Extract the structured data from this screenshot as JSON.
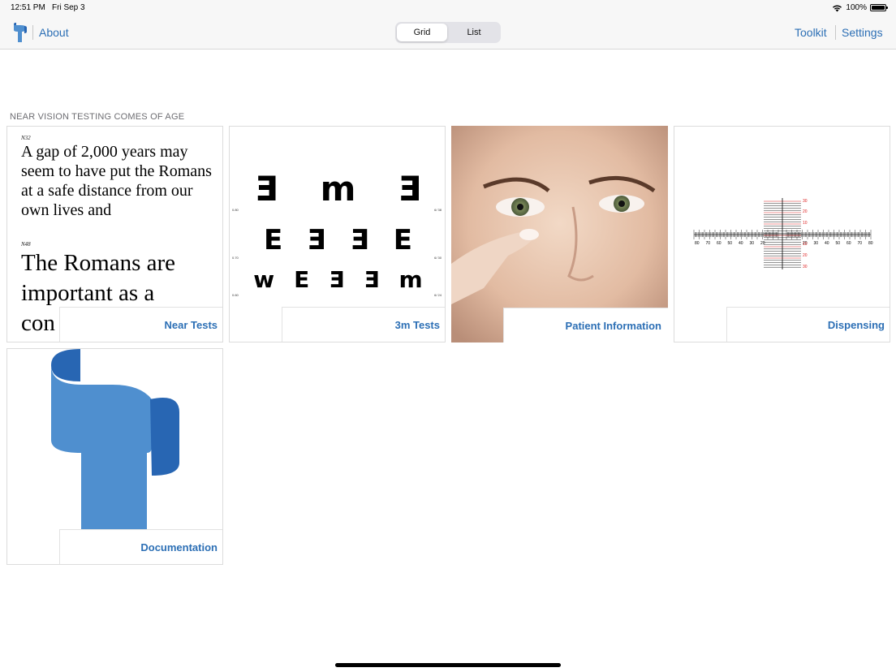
{
  "status": {
    "time": "12:51 PM",
    "date": "Fri Sep 3",
    "battery": "100%"
  },
  "nav": {
    "about": "About",
    "toolkit": "Toolkit",
    "settings": "Settings"
  },
  "segments": {
    "grid": "Grid",
    "list": "List",
    "selected": "Grid"
  },
  "section": {
    "title": "NEAR VISION TESTING COMES OF AGE"
  },
  "tiles": [
    {
      "label": "Near Tests"
    },
    {
      "label": "3m Tests"
    },
    {
      "label": "Patient Information"
    },
    {
      "label": "Dispensing"
    },
    {
      "label": "Documentation"
    }
  ],
  "near_preview": {
    "size_small": "N32",
    "para_small": "A gap of 2,000 years may seem to have put the Romans at a safe distance from our own lives and",
    "size_large": "N48",
    "para_large_1": "The Romans are",
    "para_large_2": "important as a",
    "para_large_3": "con"
  },
  "chart_preview": {
    "row1": [
      "Ǝ",
      "m",
      "Ǝ"
    ],
    "row2": [
      "E",
      "Ǝ",
      "Ǝ",
      "E"
    ],
    "row3": [
      "w",
      "E",
      "Ǝ",
      "Ǝ",
      "m"
    ],
    "left_marks": [
      "0.80",
      "0.70",
      "0.60"
    ],
    "right_marks": [
      "6/ 38",
      "6/ 30",
      "6/ 24"
    ]
  },
  "ruler_preview": {
    "horizontal_ticks": [
      "80",
      "70",
      "60",
      "50",
      "40",
      "30",
      "20",
      "20",
      "30",
      "40",
      "50",
      "60",
      "70",
      "80"
    ],
    "vertical_ticks": [
      "30",
      "20",
      "10",
      "10",
      "20",
      "30"
    ]
  },
  "colors": {
    "accent": "#2c6fb5",
    "logo_light": "#4f8fcf",
    "logo_dark": "#2866b3"
  },
  "icons": {
    "app_logo": "app-logo-icon",
    "wifi": "wifi-icon",
    "battery": "battery-icon"
  }
}
